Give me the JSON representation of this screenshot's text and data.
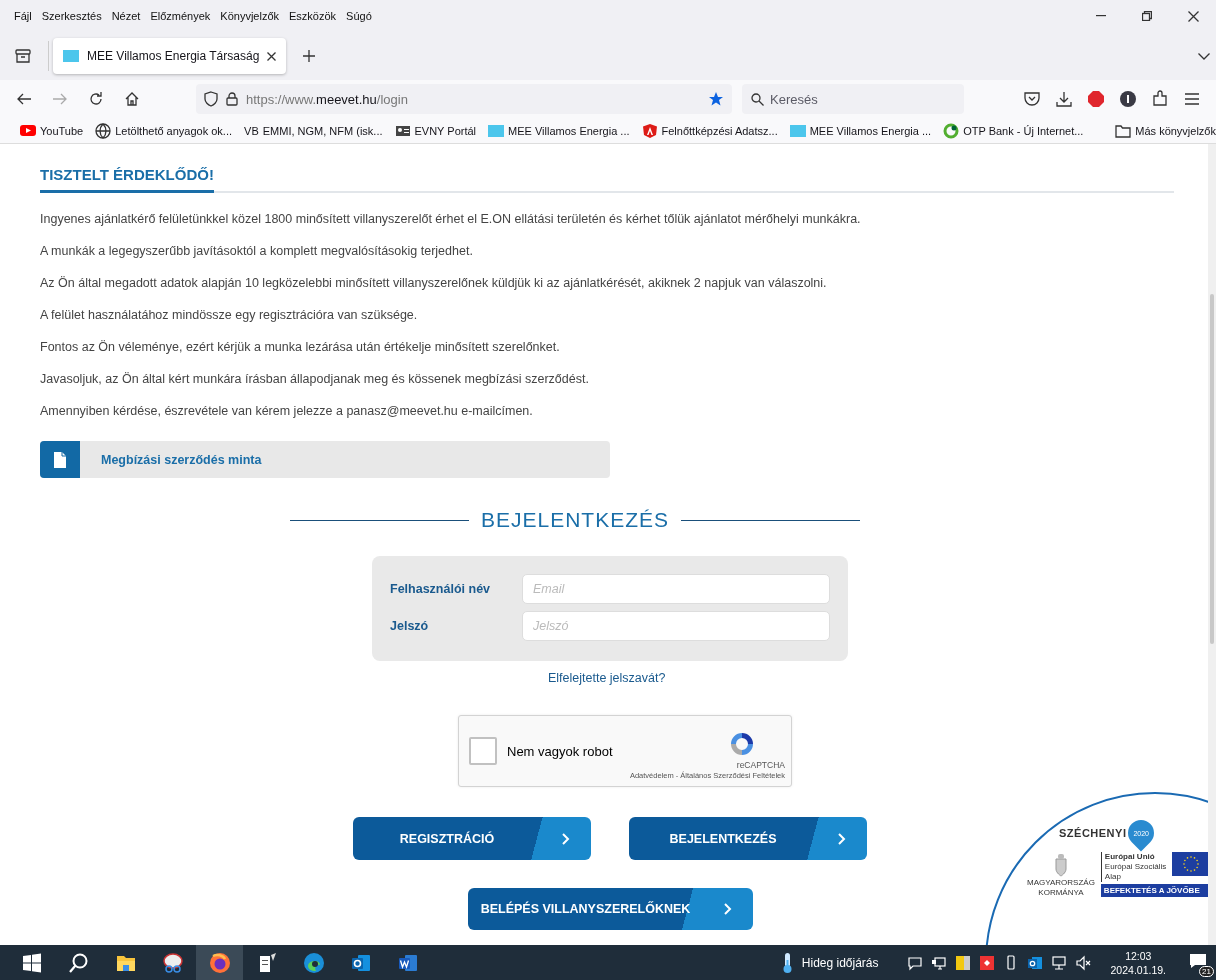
{
  "menu_bar": {
    "items": [
      "Fájl",
      "Szerkesztés",
      "Nézet",
      "Előzmények",
      "Könyvjelzők",
      "Eszközök",
      "Súgó"
    ]
  },
  "tabs": [
    {
      "label": "MEE Villamos Energia Társaság",
      "selected": true
    }
  ],
  "nav_bar": {
    "url_prefix": "https://www.",
    "url_domain": "meevet.hu",
    "url_path": "/login",
    "bookmarked": true,
    "search": {
      "placeholder": "Keresés"
    }
  },
  "bookmarks": [
    {
      "kind": "youtube",
      "label": "YouTube"
    },
    {
      "kind": "globe",
      "label": "Letölthető anyagok ok..."
    },
    {
      "kind": "text",
      "label": "EMMI, NGM, NFM (isk...",
      "prefix": "VB"
    },
    {
      "kind": "card",
      "label": "EVNY Portál"
    },
    {
      "kind": "site",
      "label": "MEE Villamos Energia ..."
    },
    {
      "kind": "shield",
      "label": "Felnőttképzési Adatsz..."
    },
    {
      "kind": "site",
      "label": "MEE Villamos Energia ..."
    },
    {
      "kind": "otp",
      "label": "OTP Bank - Új Internet..."
    },
    {
      "kind": "folder",
      "label": "Más könyvjelzők"
    }
  ],
  "page": {
    "heading": "TISZTELT ÉRDEKLŐDŐ!",
    "paragraphs": [
      "Ingyenes ajánlatkérő felületünkkel közel 1800 minősített villanyszerelőt érhet el E.ON ellátási területén és kérhet tőlük ajánlatot mérőhelyi munkákra.",
      "A munkák a legegyszerűbb javításoktól a komplett megvalósításokig terjedhet.",
      "Az Ön által megadott adatok alapján 10 legközelebbi minősített villanyszerelőnek küldjük ki az ajánlatkérését, akiknek 2 napjuk van válaszolni.",
      "A felület használatához mindössze egy regisztrációra van szüksége.",
      "Fontos az Ön véleménye, ezért kérjük a munka lezárása után értékelje minősített szerelőnket.",
      "Javasoljuk, az Ön által kért munkára írásban állapodjanak meg és kössenek megbízási szerződést.",
      "Amennyiben kérdése, észrevétele van kérem jelezze a panasz@meevet.hu e-mailcímen."
    ],
    "document_link": "Megbízási szerződés minta",
    "login_title": "BEJELENTKEZÉS",
    "fields": [
      {
        "label": "Felhasználói név",
        "placeholder": "Email"
      },
      {
        "label": "Jelszó",
        "placeholder": "Jelszó"
      }
    ],
    "forgot_link": "Elfelejtette jelszavát?",
    "captcha": {
      "label": "Nem vagyok robot",
      "checked": false,
      "brand": "reCAPTCHA",
      "links": "Adatvédelem - Általános Szerződési Feltételek"
    },
    "buttons": [
      "REGISZTRÁCIÓ",
      "BEJELENTKEZÉS"
    ],
    "electrician_button": "BELÉPÉS VILLANYSZERELŐKNEK",
    "funding_badge": {
      "title": "SZÉCHENYI",
      "year": "2020",
      "eu_lines": [
        "Európai Unió",
        "Európai Szociális",
        "Alap"
      ],
      "gov_lines": [
        "MAGYARORSZÁG",
        "KORMÁNYA"
      ],
      "slogan": "BEFEKTETÉS A JÖVŐBE"
    }
  },
  "taskbar": {
    "apps": [
      {
        "kind": "explorer",
        "active": false
      },
      {
        "kind": "snip",
        "active": false
      },
      {
        "kind": "firefox",
        "active": true
      },
      {
        "kind": "notes",
        "active": false
      },
      {
        "kind": "edge",
        "active": false
      },
      {
        "kind": "outlook",
        "active": false
      },
      {
        "kind": "word",
        "active": false
      }
    ],
    "weather": "Hideg időjárás",
    "time": "12:03",
    "date": "2024.01.19.",
    "notifications": "21"
  }
}
